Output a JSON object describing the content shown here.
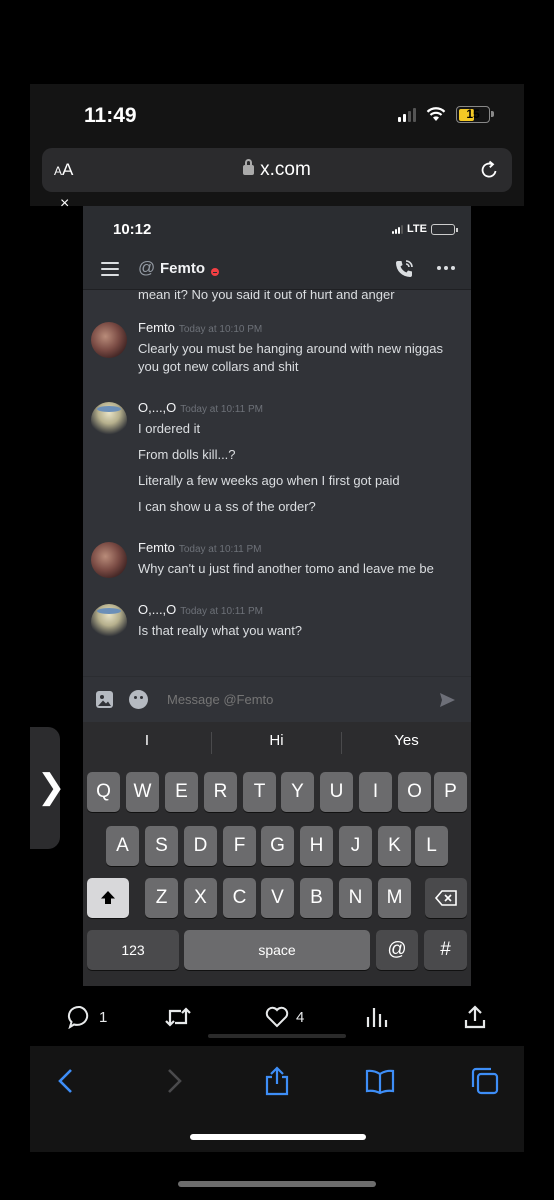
{
  "os": {
    "time": "11:49",
    "battery": "15"
  },
  "browser": {
    "aa_small": "A",
    "aa_big": "A",
    "url": "x.com",
    "close_glyph": "×",
    "side_tab_glyph": "❯"
  },
  "inner": {
    "time": "10:12",
    "network": "LTE",
    "dm_name": "Femto",
    "cut_line": "mean it? No you said it out of hurt and anger",
    "messages": [
      {
        "author": "Femto",
        "time": "Today at 10:10 PM",
        "lines": [
          "Clearly you must be hanging around with new niggas",
          "you got new collars and shit"
        ]
      },
      {
        "author": "O,...,O",
        "time": "Today at 10:11 PM",
        "lines": [
          "I ordered it",
          "From dolls kill...?",
          "Literally a few weeks ago when I first got paid",
          "I can show u a ss of the order?"
        ]
      },
      {
        "author": "Femto",
        "time": "Today at 10:11 PM",
        "lines": [
          "Why can't u just find another tomo and leave me be"
        ]
      },
      {
        "author": "O,...,O",
        "time": "Today at 10:11 PM",
        "lines": [
          "Is that really what you want?"
        ]
      }
    ],
    "composer_placeholder": "Message @Femto"
  },
  "keyboard": {
    "suggestions": [
      "I",
      "Hi",
      "Yes"
    ],
    "row1": [
      "Q",
      "W",
      "E",
      "R",
      "T",
      "Y",
      "U",
      "I",
      "O",
      "P"
    ],
    "row2": [
      "A",
      "S",
      "D",
      "F",
      "G",
      "H",
      "J",
      "K",
      "L"
    ],
    "row3": [
      "Z",
      "X",
      "C",
      "V",
      "B",
      "N",
      "M"
    ],
    "numbers_label": "123",
    "space_label": "space",
    "at_label": "@",
    "hash_label": "#"
  },
  "tweet_actions": {
    "replies": "1",
    "likes": "4"
  },
  "icons": [
    "signal-icon",
    "wifi-icon",
    "battery-icon",
    "lock-icon",
    "reload-icon",
    "menu-icon",
    "at-icon",
    "dnd-status-icon",
    "call-icon",
    "more-icon",
    "image-icon",
    "emoji-icon",
    "send-icon",
    "shift-icon",
    "delete-icon",
    "reply-icon",
    "retweet-icon",
    "like-icon",
    "views-icon",
    "share-icon",
    "back-icon",
    "forward-icon",
    "safari-share-icon",
    "bookmarks-icon",
    "tabs-icon"
  ]
}
